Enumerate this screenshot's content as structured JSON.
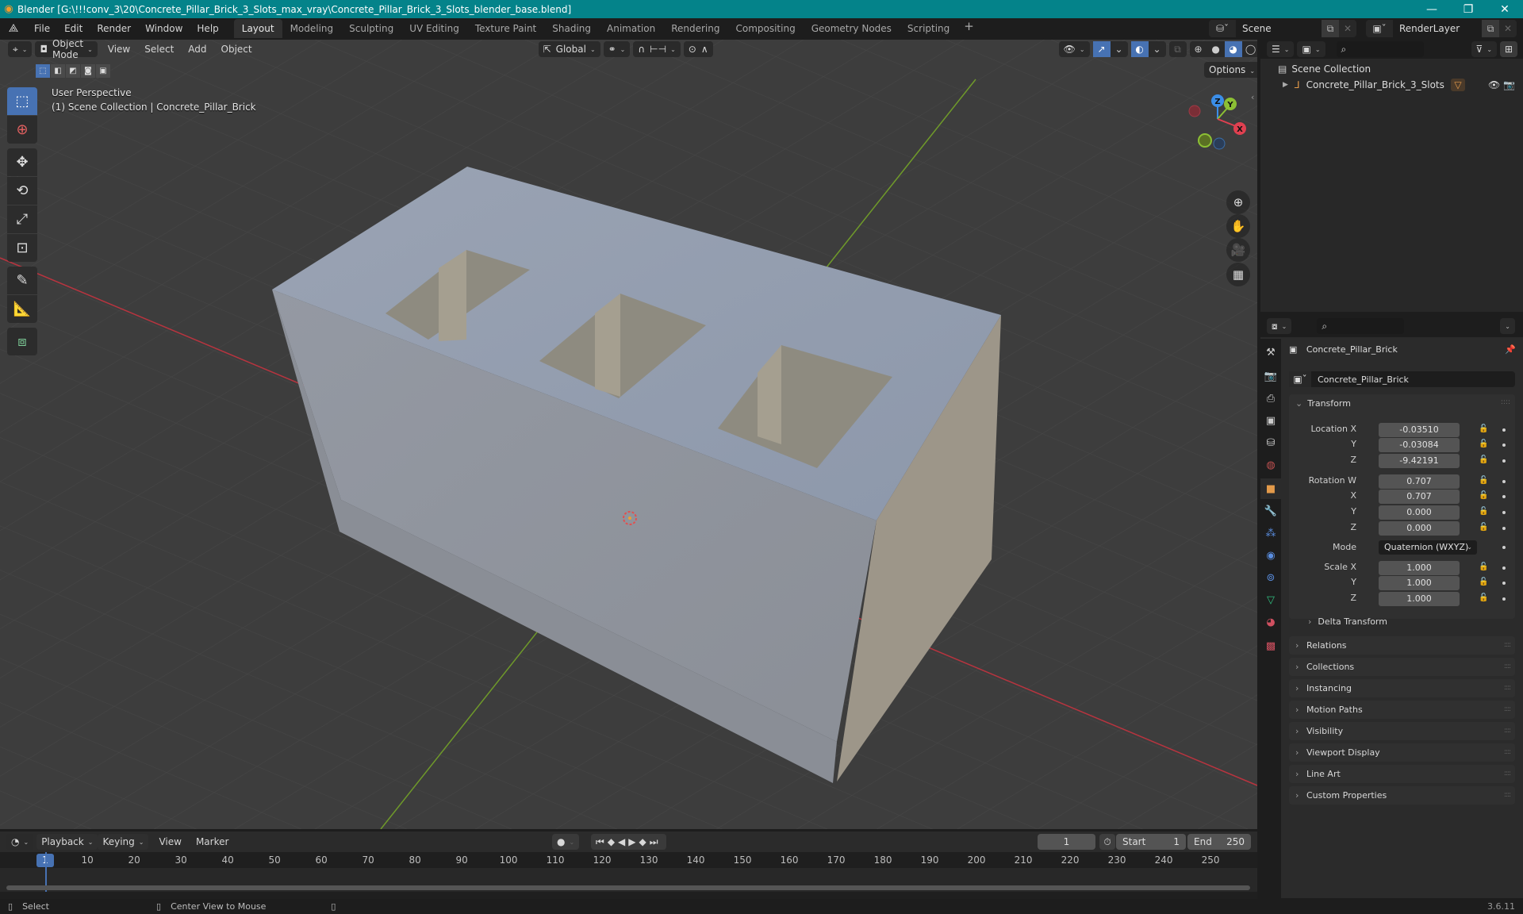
{
  "window": {
    "title": "Blender [G:\\!!!conv_3\\20\\Concrete_Pillar_Brick_3_Slots_max_vray\\Concrete_Pillar_Brick_3_Slots_blender_base.blend]",
    "controls": {
      "minimize": "—",
      "maximize": "❐",
      "close": "✕"
    }
  },
  "menubar": {
    "menus": [
      "File",
      "Edit",
      "Render",
      "Window",
      "Help"
    ],
    "workspaces": [
      "Layout",
      "Modeling",
      "Sculpting",
      "UV Editing",
      "Texture Paint",
      "Shading",
      "Animation",
      "Rendering",
      "Compositing",
      "Geometry Nodes",
      "Scripting"
    ],
    "active_workspace": "Layout",
    "add_workspace": "+",
    "scene": "Scene",
    "view_layer": "RenderLayer"
  },
  "viewport": {
    "mode": "Object Mode",
    "menus": [
      "View",
      "Select",
      "Add",
      "Object"
    ],
    "transform_orientation": "Global",
    "options_label": "Options",
    "view_name": "User Perspective",
    "collection_info": "(1) Scene Collection | Concrete_Pillar_Brick",
    "shading_mode": "Material Preview",
    "gizmo_axes": [
      "X",
      "Y",
      "Z"
    ],
    "tools": [
      "select-box",
      "cursor",
      "move",
      "rotate",
      "scale",
      "transform",
      "annotate",
      "measure",
      "add-cube"
    ]
  },
  "outliner": {
    "root": "Scene Collection",
    "items": [
      {
        "name": "Concrete_Pillar_Brick_3_Slots",
        "type": "empty",
        "visible": true,
        "renderable": true
      }
    ]
  },
  "properties": {
    "object_name": "Concrete_Pillar_Brick",
    "object_datablock": "Concrete_Pillar_Brick",
    "transform_label": "Transform",
    "location": {
      "label": "Location X",
      "x": "-0.03510",
      "y": "-0.03084",
      "z": "-9.42191"
    },
    "rotation": {
      "label": "Rotation W",
      "w": "0.707",
      "x": "0.707",
      "y": "0.000",
      "z": "0.000"
    },
    "mode_label": "Mode",
    "mode_value": "Quaternion (WXYZ)",
    "scale": {
      "label": "Scale X",
      "x": "1.000",
      "y": "1.000",
      "z": "1.000"
    },
    "axis_labels": {
      "x": "X",
      "y": "Y",
      "z": "Z"
    },
    "delta_transform": "Delta Transform",
    "panels": [
      "Relations",
      "Collections",
      "Instancing",
      "Motion Paths",
      "Visibility",
      "Viewport Display",
      "Line Art",
      "Custom Properties"
    ]
  },
  "timeline": {
    "menus": [
      "Playback",
      "Keying",
      "View",
      "Marker"
    ],
    "current_frame": "1",
    "start_label": "Start",
    "start": "1",
    "end_label": "End",
    "end": "250",
    "ticks": [
      "10",
      "20",
      "30",
      "40",
      "50",
      "60",
      "70",
      "80",
      "90",
      "100",
      "110",
      "120",
      "130",
      "140",
      "150",
      "160",
      "170",
      "180",
      "190",
      "200",
      "210",
      "220",
      "230",
      "240",
      "250"
    ]
  },
  "statusbar": {
    "left_action": "Select",
    "middle_action": "Center View to Mouse",
    "version": "3.6.11"
  },
  "colors": {
    "titlebar": "#04838a",
    "accent": "#4772b3",
    "x_axis": "#e04050",
    "y_axis": "#8cc034",
    "z_axis": "#3b8ee8"
  }
}
